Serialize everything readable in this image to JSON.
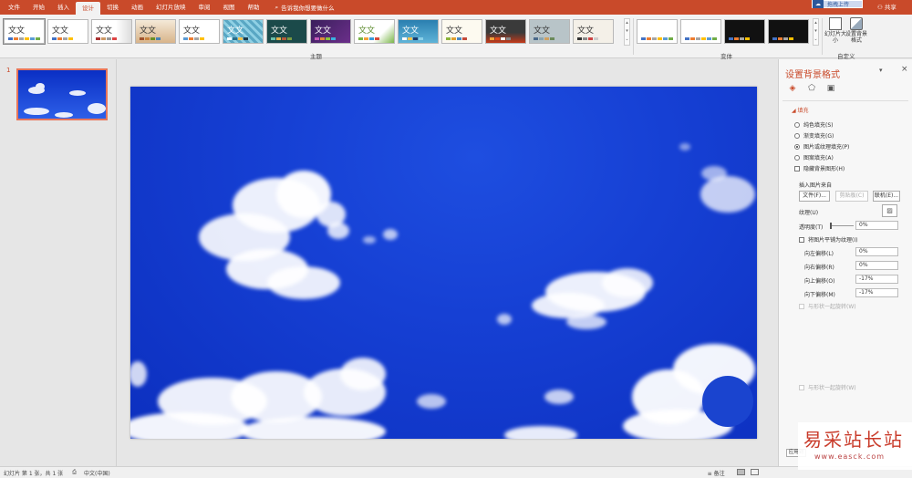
{
  "menu": {
    "tabs": [
      "文件",
      "开始",
      "插入",
      "设计",
      "切换",
      "动画",
      "幻灯片放映",
      "审阅",
      "视图",
      "帮助"
    ],
    "active_index": 3,
    "tell_me": "告诉我你想要做什么",
    "sync_label": "拖拽上传",
    "share_label": "共享"
  },
  "ribbon": {
    "themes_label": "主题",
    "variants_label": "变体",
    "customize_label": "自定义",
    "theme_text": "文文",
    "slide_size_label": "幻灯片大小",
    "format_bg_label": "设置背景格式"
  },
  "slides_pane": {
    "number": "1"
  },
  "panel": {
    "title": "设置背景格式",
    "section_fill": "填充",
    "fill_options": [
      "纯色填充(S)",
      "渐变填充(G)",
      "图片或纹理填充(P)",
      "图案填充(A)"
    ],
    "selected_fill": 2,
    "hide_bg_graphics": "隐藏背景图形(H)",
    "insert_picture_from": "插入图片来自",
    "btn_file": "文件(F)...",
    "btn_clipboard": "剪贴板(C)",
    "btn_online": "联机(E)...",
    "texture_label": "纹理(U)",
    "transparency_label": "透明度(T)",
    "transparency_value": "0%",
    "tile_label": "将图片平铺为纹理(I)",
    "offsets": [
      {
        "label": "向左偏移(L)",
        "value": "0%"
      },
      {
        "label": "向右偏移(R)",
        "value": "0%"
      },
      {
        "label": "向上偏移(O)",
        "value": "-17%"
      },
      {
        "label": "向下偏移(M)",
        "value": "-17%"
      }
    ],
    "rotate_with_shape": "与形状一起旋转(W)",
    "rotate_with_shape_bottom": "与形状一起旋转(W)"
  },
  "status": {
    "slide_info": "幻灯片 第 1 张，共 1 张",
    "language": "中文(中国)",
    "notes_label": "备注",
    "tooltip": "应用到"
  },
  "watermark": {
    "title": "易采站长站",
    "url": "www.easck.com"
  },
  "colors": {
    "accent": "#c94a2a",
    "sky": "#1640d4"
  }
}
